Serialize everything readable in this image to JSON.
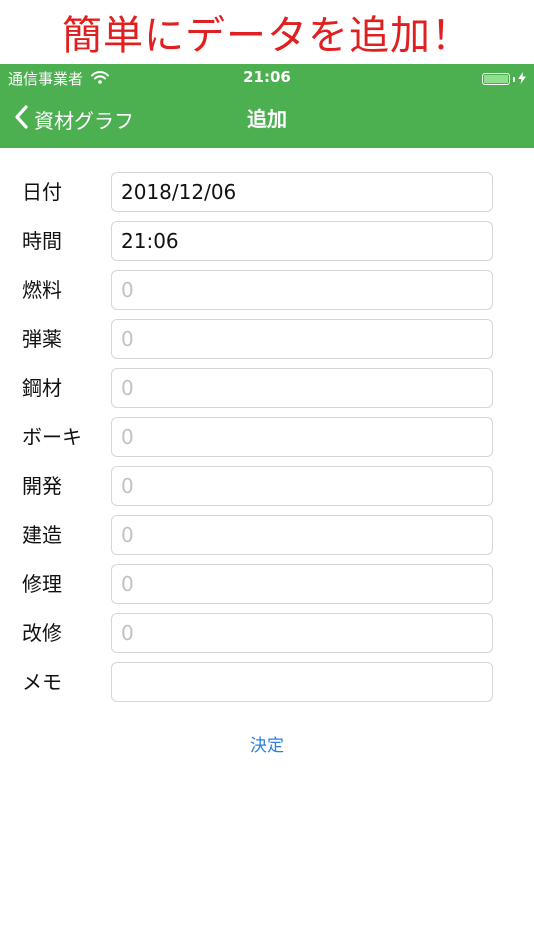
{
  "banner": {
    "text": "簡単にデータを追加！",
    "color": "#e02020"
  },
  "status_bar": {
    "carrier": "通信事業者",
    "time": "21:06",
    "wifi_icon": "wifi-icon",
    "battery_icon": "battery-icon",
    "charging_icon": "bolt-icon"
  },
  "nav": {
    "back_label": "資材グラフ",
    "back_icon": "chevron-left-icon",
    "title": "追加",
    "color": "#4caf50"
  },
  "form": {
    "date": {
      "label": "日付",
      "value": "2018/12/06",
      "placeholder": ""
    },
    "time": {
      "label": "時間",
      "value": "21:06",
      "placeholder": ""
    },
    "fuel": {
      "label": "燃料",
      "value": "",
      "placeholder": "0"
    },
    "ammo": {
      "label": "弾薬",
      "value": "",
      "placeholder": "0"
    },
    "steel": {
      "label": "鋼材",
      "value": "",
      "placeholder": "0"
    },
    "bauxite": {
      "label": "ボーキ",
      "value": "",
      "placeholder": "0"
    },
    "develop": {
      "label": "開発",
      "value": "",
      "placeholder": "0"
    },
    "build": {
      "label": "建造",
      "value": "",
      "placeholder": "0"
    },
    "repair": {
      "label": "修理",
      "value": "",
      "placeholder": "0"
    },
    "remodel": {
      "label": "改修",
      "value": "",
      "placeholder": "0"
    },
    "memo": {
      "label": "メモ",
      "value": "",
      "placeholder": ""
    }
  },
  "submit_label": "決定",
  "accent_color": "#2b7fe0"
}
